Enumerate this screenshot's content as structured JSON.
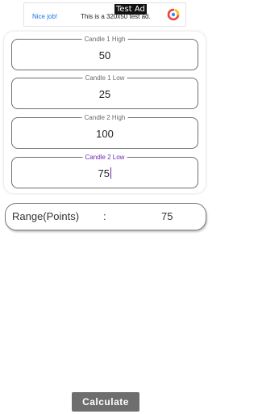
{
  "ad": {
    "tag": "Test Ad",
    "headline": "Nice job!",
    "text": "This is a 320x50 test ad.",
    "logo_icon": "admob-logo-icon"
  },
  "fields": [
    {
      "label": "Candle 1 High",
      "value": "50",
      "focused": false
    },
    {
      "label": "Candle 1 Low",
      "value": "25",
      "focused": false
    },
    {
      "label": "Candle 2 High",
      "value": "100",
      "focused": false
    },
    {
      "label": "Candle 2 Low",
      "value": "75",
      "focused": true
    }
  ],
  "result": {
    "label": "Range(Points)",
    "separator": ":",
    "value": "75"
  },
  "calculate_button": {
    "label": "Calculate"
  },
  "colors": {
    "focus": "#6a2cb0",
    "button": "#6e6e6e",
    "link": "#1a73e8"
  }
}
